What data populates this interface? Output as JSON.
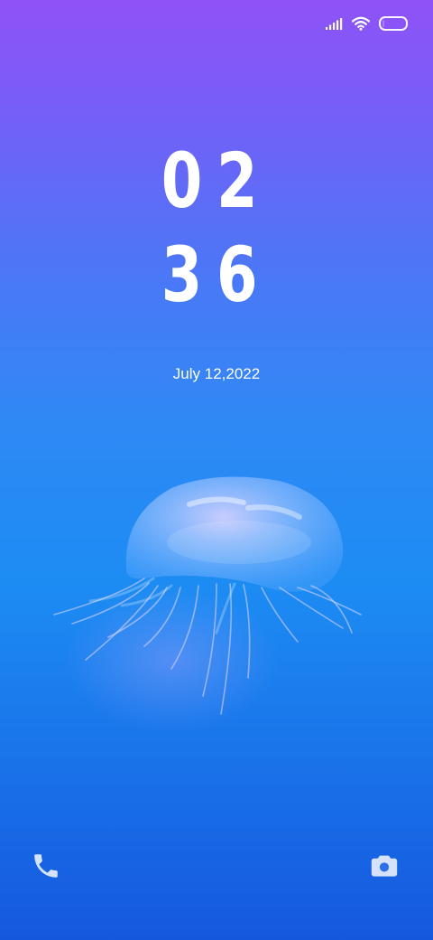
{
  "status_bar": {
    "signal_icon": "signal-bars-icon",
    "wifi_icon": "wifi-icon",
    "battery_icon": "battery-icon",
    "battery_level_fraction": 0.1
  },
  "lockscreen": {
    "hours": "02",
    "minutes": "36",
    "date": "July 12,2022"
  },
  "shortcuts": {
    "left_icon": "phone-icon",
    "right_icon": "camera-icon"
  },
  "colors": {
    "gradient_top": "#8f52f6",
    "gradient_middle": "#2f89f5",
    "gradient_bottom": "#1558de",
    "text": "#ffffff"
  }
}
